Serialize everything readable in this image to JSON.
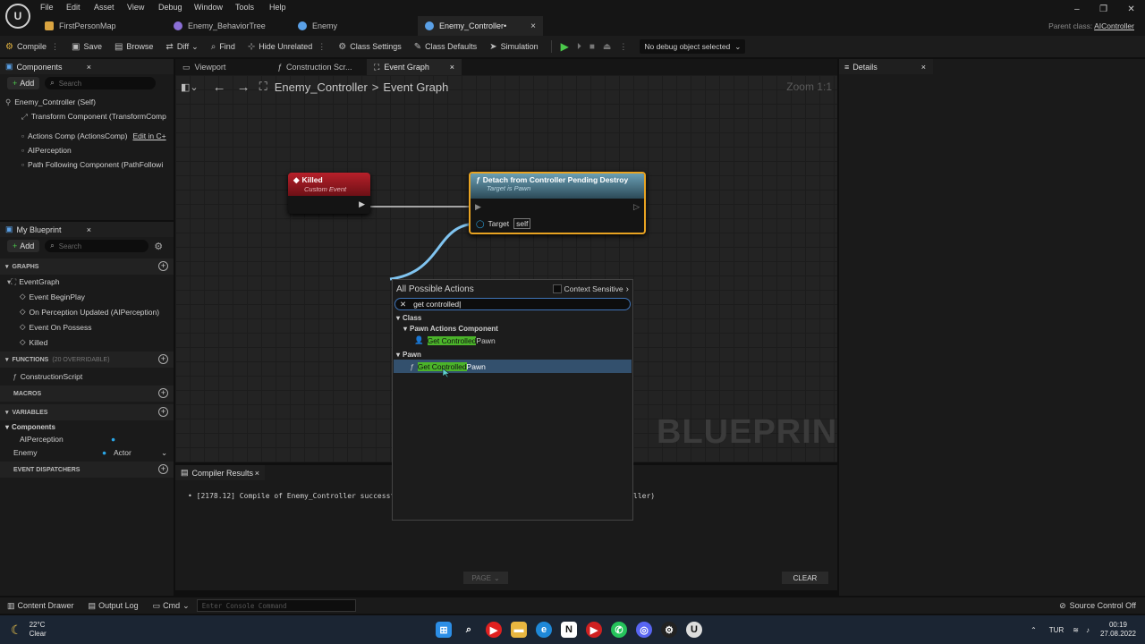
{
  "menu": [
    "File",
    "Edit",
    "Asset",
    "View",
    "Debug",
    "Window",
    "Tools",
    "Help"
  ],
  "tabs": [
    {
      "label": "FirstPersonMap",
      "color": "#d9a441"
    },
    {
      "label": "Enemy_BehaviorTree",
      "color": "#8b6fd6"
    },
    {
      "label": "Enemy",
      "color": "#5aa0e6"
    },
    {
      "label": "Enemy_Controller•",
      "color": "#5aa0e6"
    }
  ],
  "parent_class": {
    "label": "Parent class:",
    "value": "AIController"
  },
  "toolbar": {
    "compile": "Compile",
    "save": "Save",
    "browse": "Browse",
    "diff": "Diff",
    "find": "Find",
    "hide_unrelated": "Hide Unrelated",
    "class_settings": "Class Settings",
    "class_defaults": "Class Defaults",
    "simulation": "Simulation",
    "debug_object": "No debug object selected"
  },
  "components": {
    "title": "Components",
    "add": "Add",
    "search": "Search",
    "items": [
      "Enemy_Controller (Self)",
      "Transform Component (TransformComp",
      "Actions Comp (ActionsComp)",
      "AIPerception",
      "Path Following Component (PathFollowi"
    ],
    "edit_link": "Edit in C+"
  },
  "editor_tabs": [
    "Viewport",
    "Construction Scr...",
    "Event Graph"
  ],
  "details": {
    "title": "Details"
  },
  "breadcrumb": {
    "blueprint": "Enemy_Controller",
    "sep": ">",
    "graph": "Event Graph",
    "zoom": "Zoom 1:1"
  },
  "my_blueprint": {
    "title": "My Blueprint",
    "add": "Add",
    "search": "Search",
    "graphs_label": "GRAPHS",
    "event_graph": "EventGraph",
    "events": [
      "Event BeginPlay",
      "On Perception Updated (AIPerception)",
      "Event On Possess",
      "Killed"
    ],
    "functions_label": "FUNCTIONS",
    "functions_note": "(20 OVERRIDABLE)",
    "construction": "ConstructionScript",
    "macros_label": "MACROS",
    "variables_label": "VARIABLES",
    "components_label": "Components",
    "vars": [
      {
        "name": "AIPerception",
        "type": ""
      },
      {
        "name": "Enemy",
        "type": "Actor"
      }
    ],
    "dispatchers_label": "EVENT DISPATCHERS"
  },
  "nodes": {
    "killed": {
      "title": "Killed",
      "subtitle": "Custom Event"
    },
    "detach": {
      "title": "Detach from Controller Pending Destroy",
      "subtitle": "Target is Pawn",
      "pin": "Target",
      "pin_value": "self"
    }
  },
  "watermark": "BLUEPRINT",
  "popup": {
    "header": "All Possible Actions",
    "context": "Context Sensitive",
    "query": "get controlled",
    "cat_class": "Class",
    "cat_pawn_actions": "Pawn Actions Component",
    "item1": {
      "hl": "Get Controlled",
      "rest": " Pawn"
    },
    "cat_pawn": "Pawn",
    "item2": {
      "hl": "Get Controlled",
      "rest": " Pawn"
    }
  },
  "compiler": {
    "title": "Compiler Results",
    "msg_left": "[2178.12] Compile of Enemy_Controller successf",
    "msg_right": "ller)",
    "page": "PAGE",
    "clear": "CLEAR"
  },
  "status": {
    "content_drawer": "Content Drawer",
    "output_log": "Output Log",
    "cmd": "Cmd",
    "console_placeholder": "Enter Console Command",
    "source_control": "Source Control Off"
  },
  "taskbar": {
    "temp": "22°C",
    "weather": "Clear",
    "lang": "TUR",
    "time": "00:19",
    "date": "27.08.2022"
  }
}
